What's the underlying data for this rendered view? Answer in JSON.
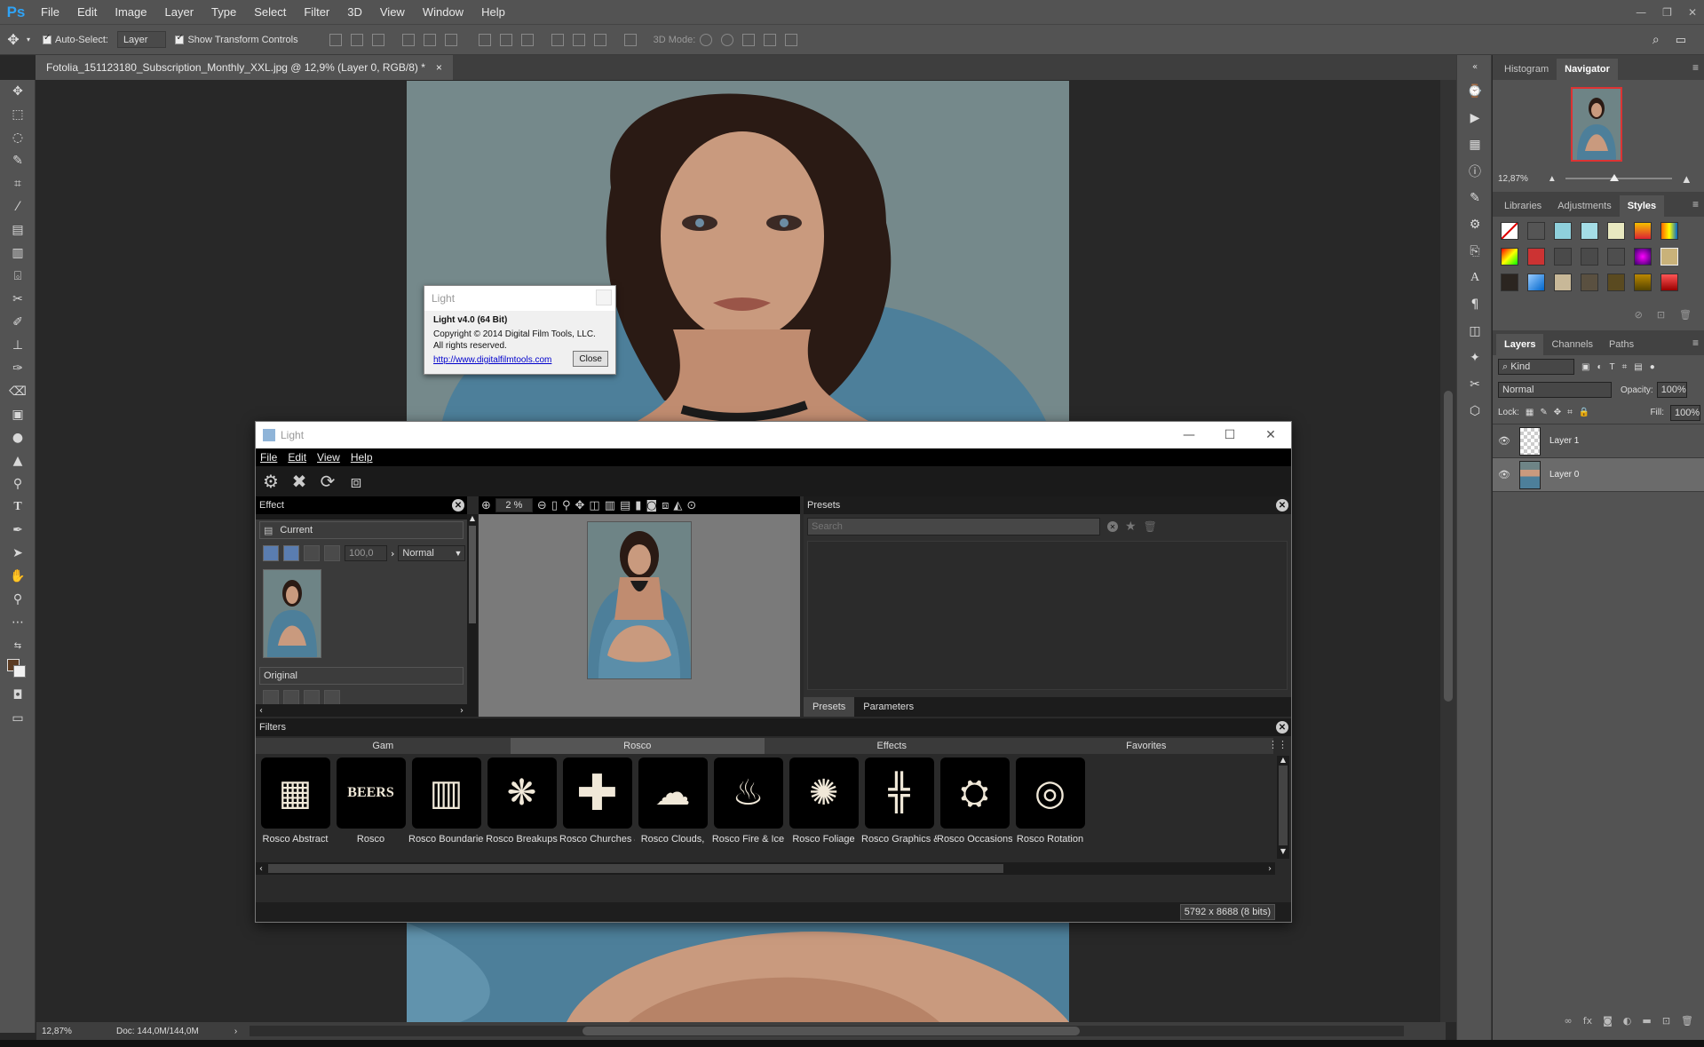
{
  "app": {
    "logo": "Ps",
    "menu": [
      "File",
      "Edit",
      "Image",
      "Layer",
      "Type",
      "Select",
      "Filter",
      "3D",
      "View",
      "Window",
      "Help"
    ]
  },
  "options": {
    "auto_select_label": "Auto-Select:",
    "auto_select_value": "Layer",
    "show_transform_label": "Show Transform Controls",
    "mode_3d_label": "3D Mode:"
  },
  "document": {
    "tab_title": "Fotolia_151123180_Subscription_Monthly_XXL.jpg @ 12,9% (Layer 0, RGB/8) *",
    "tab_close": "×",
    "status_zoom": "12,87%",
    "status_doc": "Doc: 144,0M/144,0M"
  },
  "navigator": {
    "tabs": [
      "Histogram",
      "Navigator"
    ],
    "zoom": "12,87%"
  },
  "styles_panel": {
    "tabs": [
      "Libraries",
      "Adjustments",
      "Styles"
    ]
  },
  "layers_panel": {
    "tabs": [
      "Layers",
      "Channels",
      "Paths"
    ],
    "filter_label": "Kind",
    "blend_mode": "Normal",
    "opacity_label": "Opacity:",
    "opacity_value": "100%",
    "lock_label": "Lock:",
    "fill_label": "Fill:",
    "fill_value": "100%",
    "layers": [
      {
        "name": "Layer 1"
      },
      {
        "name": "Layer 0"
      }
    ]
  },
  "about_dialog": {
    "title": "Light",
    "heading": "Light v4.0 (64 Bit)",
    "copyright": "Copyright © 2014 Digital Film Tools, LLC.",
    "rights": "All rights reserved.",
    "link": "http://www.digitalfilmtools.com",
    "close_label": "Close"
  },
  "light_window": {
    "title": "Light",
    "menu": [
      "File",
      "Edit",
      "View",
      "Help"
    ],
    "effect_header": "Effect",
    "current_label": "Current",
    "amount_value": "100,0",
    "blend_value": "Normal",
    "original_label": "Original",
    "zoom_value": "2 %",
    "presets_header": "Presets",
    "search_placeholder": "Search",
    "bottom_tabs": [
      "Presets",
      "Parameters"
    ],
    "filters_header": "Filters",
    "filter_tabs": [
      "Gam",
      "Rosco",
      "Effects",
      "Favorites"
    ],
    "filters": [
      {
        "label": "Rosco Abstract",
        "glyph": "▦"
      },
      {
        "label": "Rosco",
        "glyph": "BEERS"
      },
      {
        "label": "Rosco Boundaries",
        "glyph": "▥"
      },
      {
        "label": "Rosco Breakups",
        "glyph": "❋"
      },
      {
        "label": "Rosco Churches &",
        "glyph": "✚"
      },
      {
        "label": "Rosco Clouds,",
        "glyph": "☁"
      },
      {
        "label": "Rosco Fire & Ice",
        "glyph": "♨"
      },
      {
        "label": "Rosco Foliage",
        "glyph": "✺"
      },
      {
        "label": "Rosco Graphics &",
        "glyph": "╬"
      },
      {
        "label": "Rosco Occasions",
        "glyph": "⛭"
      },
      {
        "label": "Rosco Rotation",
        "glyph": "◎"
      }
    ],
    "status": "5792 x 8688 (8 bits)"
  },
  "colors": {
    "ps_panel": "#535353",
    "ps_dark": "#282828",
    "ps_accent": "#2fa3f6",
    "photo_bg": "#7b8d8f",
    "skin": "#c99a7e",
    "chair": "#4d7f9a"
  }
}
